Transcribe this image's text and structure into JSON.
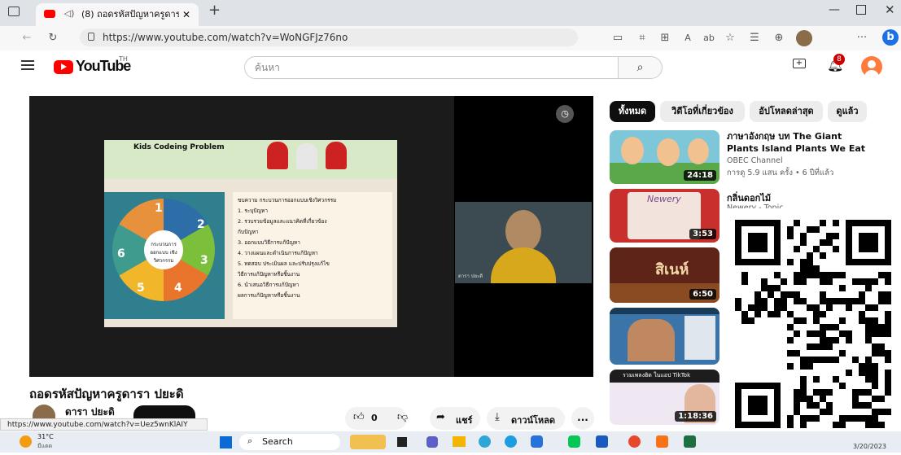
{
  "browser": {
    "tab_title": "(8) ถอดรหัสปัญหาครูดารา ปยะดิ",
    "url": "https://www.youtube.com/watch?v=WoNGFJz76no",
    "new_tab": "+",
    "profile_initial": "b"
  },
  "yt": {
    "logo": "YouTube",
    "logo_sup": "TH",
    "search_placeholder": "ค้นหา",
    "notif_count": "8"
  },
  "video": {
    "title": "ถอดรหัสปัญหาครูดารา ปยะดิ",
    "channel": "ดารา ปยะดิ",
    "likes": "0",
    "share_label": "แชร์",
    "download_label": "ดาวน์โหลด",
    "more": "...",
    "slide_header": "Kids Codeing Problem",
    "cam_caption": "ดารา ปยะดิ",
    "slide_center": "กระบวนการ ออกแบบ เชิงวิศวกรรม",
    "slide_steps": [
      "ขบความ กระบวนการออกแบบเชิงวิศวกรรม",
      "1. ระบุปัญหา",
      "2. รวบรวมข้อมูลและแนวคิดที่เกี่ยวข้อง",
      "กับปัญหา",
      "3. ออกแบบวิธีการแก้ปัญหา",
      "4. วางแผนและดำเนินการแก้ปัญหา",
      "5. ทดสอบ ประเมินผล และปรับปรุงแก้ไข",
      "วิธีการแก้ปัญหาหรือชิ้นงาน",
      "6. นำเสนอวิธีการแก้ปัญหา",
      "ผลการแก้ปัญหาหรือชิ้นงาน"
    ],
    "wheel_labels": [
      "1",
      "2",
      "3",
      "4",
      "5",
      "6"
    ]
  },
  "sidebar": {
    "chips": [
      "ทั้งหมด",
      "วิดีโอที่เกี่ยวข้อง",
      "อัปโหลดล่าสุด",
      "ดูแล้ว"
    ],
    "items": [
      {
        "title": "ภาษาอังกฤษ บท The Giant Plants Island Plants We Eat",
        "channel": "OBEC Channel",
        "meta": "การดู 5.9 แสน ครั้ง • 6 ปีที่แล้ว",
        "duration": "24:18"
      },
      {
        "title": "กลิ่นดอกไม้",
        "channel": "Newery - Topic",
        "meta": "",
        "duration": "3:53",
        "thumb_text": "Newery"
      },
      {
        "title": "",
        "channel": "",
        "meta": "",
        "duration": "6:50",
        "thumb_text": "สิเนห์"
      },
      {
        "title": "",
        "channel": "",
        "meta": "",
        "duration": ""
      },
      {
        "title": "",
        "channel": "",
        "meta": "",
        "duration": "1:18:36",
        "thumb_text": "รวมเพลงฮิต ในแอป TikTok"
      }
    ]
  },
  "status_url": "https://www.youtube.com/watch?v=Uez5wnKlAIY",
  "taskbar": {
    "temp": "31°C",
    "weather_sub": "มีแดด",
    "search_label": "Search",
    "date": "3/20/2023"
  },
  "colors": {
    "yt_red": "#ff0000",
    "accent_blue": "#065fd4"
  }
}
